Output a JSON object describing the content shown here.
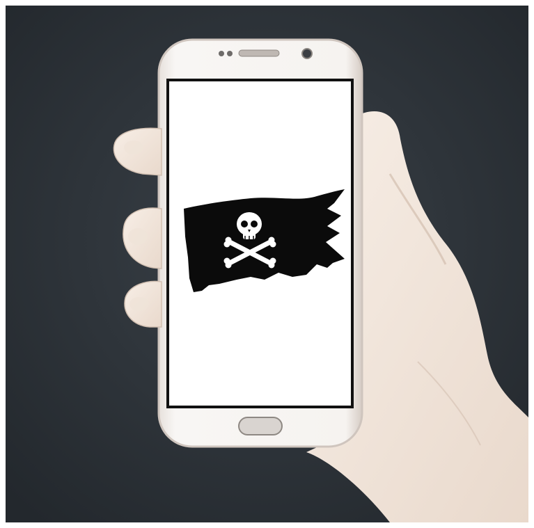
{
  "scene": {
    "subject": "smartphone-in-hand",
    "screen_content": "pirate-flag-skull-and-crossbones"
  },
  "colors": {
    "background": "#2f353b",
    "phone_body": "#f1eeeb",
    "phone_rim": "#d8cfc9",
    "screen": "#ffffff",
    "flag": "#0b0b0b",
    "skin": "#f2e8df",
    "skin_shadow": "#d9c7b8"
  }
}
